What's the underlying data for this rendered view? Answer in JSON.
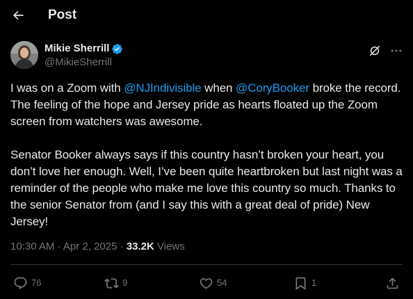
{
  "header": {
    "title": "Post"
  },
  "author": {
    "display_name": "Mikie Sherrill",
    "handle": "@MikieSherrill",
    "verified": true,
    "verified_color": "#1d9bf0"
  },
  "tweet": {
    "para1": {
      "t1": "I was on a Zoom with ",
      "mention1": "@NJIndivisible",
      "t2": " when ",
      "mention2": "@CoryBooker",
      "t3": " broke the record. The feeling of the hope and Jersey pride as hearts floated up the Zoom screen from watchers was awesome."
    },
    "para2": "Senator Booker always says if this country hasn’t broken your heart, you don’t love her enough. Well, I’ve been quite heartbroken but last night was a reminder of the people who make me love this country so much. Thanks to the senior Senator from (and I say this with a great deal of pride) New Jersey!"
  },
  "meta": {
    "time": "10:30 AM",
    "sep1": " · ",
    "date": "Apr 2, 2025",
    "sep2": " · ",
    "views_count": "33.2K",
    "views_label": " Views"
  },
  "actions": {
    "replies": "76",
    "reposts": "9",
    "likes": "54",
    "bookmarks": "1"
  },
  "colors": {
    "background": "#000000",
    "text": "#e7e9ea",
    "muted": "#71767b",
    "accent": "#1d9bf0",
    "divider": "#2f3336"
  },
  "icons": {
    "back": "arrow-left-icon",
    "grok": "grok-icon",
    "more": "more-dots-icon",
    "reply": "reply-icon",
    "repost": "repost-icon",
    "like": "heart-icon",
    "bookmark": "bookmark-icon",
    "share": "share-icon"
  }
}
